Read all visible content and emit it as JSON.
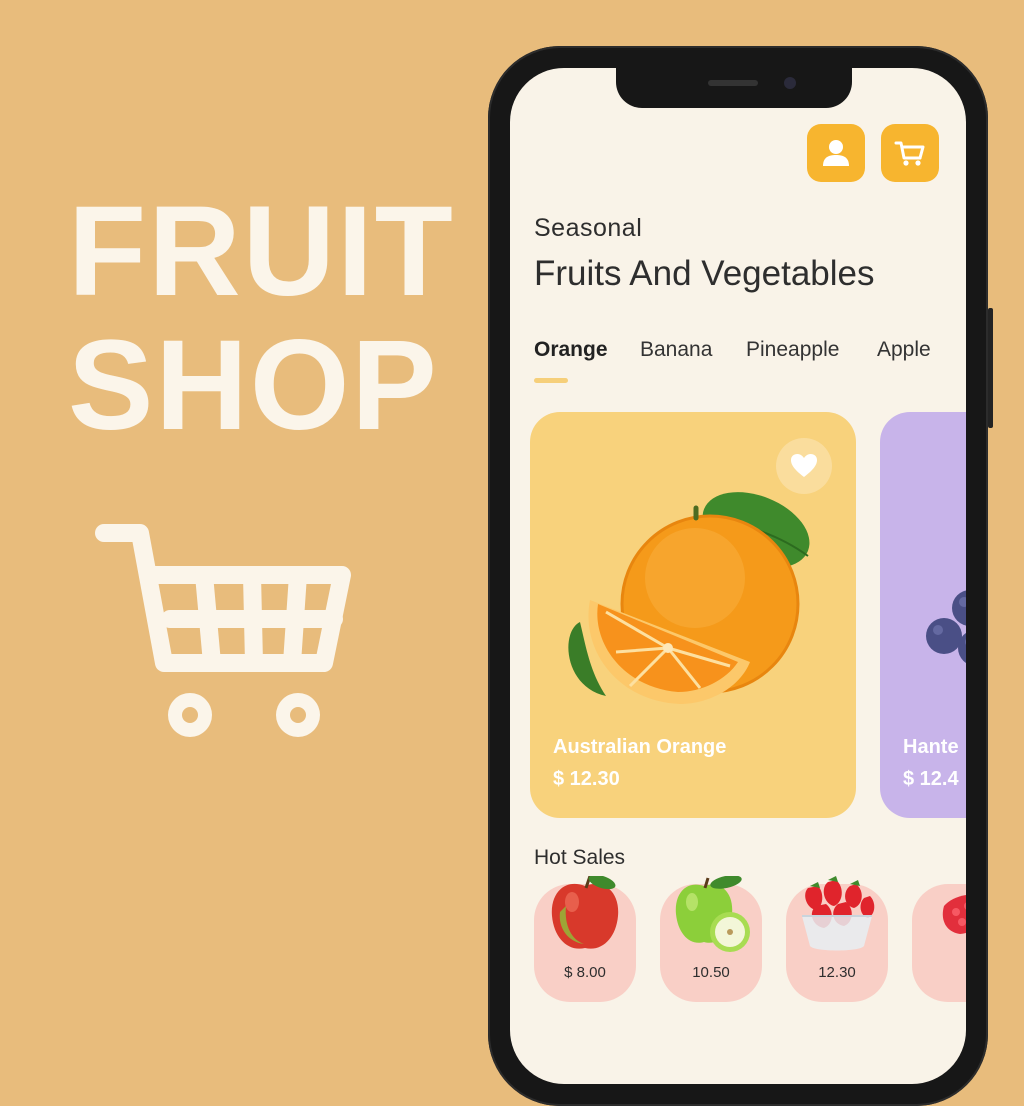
{
  "brand": {
    "title_line1": "FRUIT",
    "title_line2": "SHOP",
    "cart_icon": "shopping-cart-icon",
    "color": "#fbf5ea",
    "background": "#e8bc7c"
  },
  "header": {
    "profile_icon": "user-icon",
    "cart_icon": "cart-icon",
    "accent": "#f7b52f"
  },
  "intro": {
    "subtitle": "Seasonal",
    "heading": "Fruits And Vegetables"
  },
  "tabs": [
    {
      "label": "Orange",
      "active": true
    },
    {
      "label": "Banana",
      "active": false
    },
    {
      "label": "Pineapple",
      "active": false
    },
    {
      "label": "Apple",
      "active": false
    }
  ],
  "featured": [
    {
      "name": "Australian Orange",
      "price": "$ 12.30",
      "color": "#f8d27c",
      "icon": "orange-fruit-image"
    },
    {
      "name": "Hante",
      "price": "$ 12.4",
      "color": "#c8b4ea",
      "icon": "grapes-image"
    }
  ],
  "hot_sales": {
    "label": "Hot Sales",
    "items": [
      {
        "price": "$ 8.00",
        "icon": "red-apple-image"
      },
      {
        "price": "10.50",
        "icon": "green-apple-image"
      },
      {
        "price": "12.30",
        "icon": "strawberry-bowl-image"
      },
      {
        "price": "",
        "icon": "raspberry-image"
      }
    ]
  }
}
